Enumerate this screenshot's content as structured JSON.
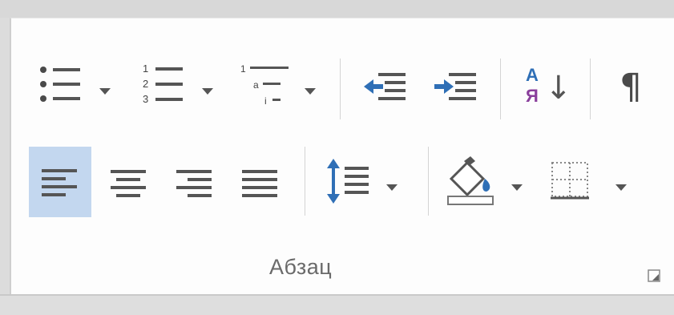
{
  "ribbon": {
    "group_label": "Абзац",
    "row1": {
      "bullets": {
        "icon": "bullets-icon",
        "has_dropdown": true
      },
      "numbering": {
        "icon": "numbering-icon",
        "number_labels": [
          "1",
          "2",
          "3"
        ],
        "has_dropdown": true
      },
      "multilevel_list": {
        "icon": "multilevel-list-icon",
        "level_labels": [
          "1",
          "a",
          "i"
        ],
        "has_dropdown": true
      },
      "decrease_indent": {
        "icon": "decrease-indent-icon"
      },
      "increase_indent": {
        "icon": "increase-indent-icon"
      },
      "sort": {
        "icon": "sort-icon",
        "letters": [
          "А",
          "Я"
        ],
        "arrow": "↓"
      },
      "show_marks": {
        "icon": "pilcrow-icon",
        "glyph": "¶"
      }
    },
    "row2": {
      "align_left": {
        "icon": "align-left-icon",
        "selected": true
      },
      "align_center": {
        "icon": "align-center-icon",
        "selected": false
      },
      "align_right": {
        "icon": "align-right-icon",
        "selected": false
      },
      "justify": {
        "icon": "justify-icon",
        "selected": false
      },
      "line_spacing": {
        "icon": "line-spacing-icon",
        "has_dropdown": true
      },
      "shading": {
        "icon": "shading-icon",
        "has_dropdown": true
      },
      "borders": {
        "icon": "borders-icon",
        "has_dropdown": true
      }
    },
    "dialog_launcher": {
      "icon": "dialog-launcher-icon"
    }
  },
  "colors": {
    "selected_bg": "#c3d7ef",
    "icon_dark": "#4a4a4a",
    "indent_blue": "#2f6fb6",
    "sort_blue": "#2f6fb6",
    "sort_purple": "#8a3f9c"
  }
}
